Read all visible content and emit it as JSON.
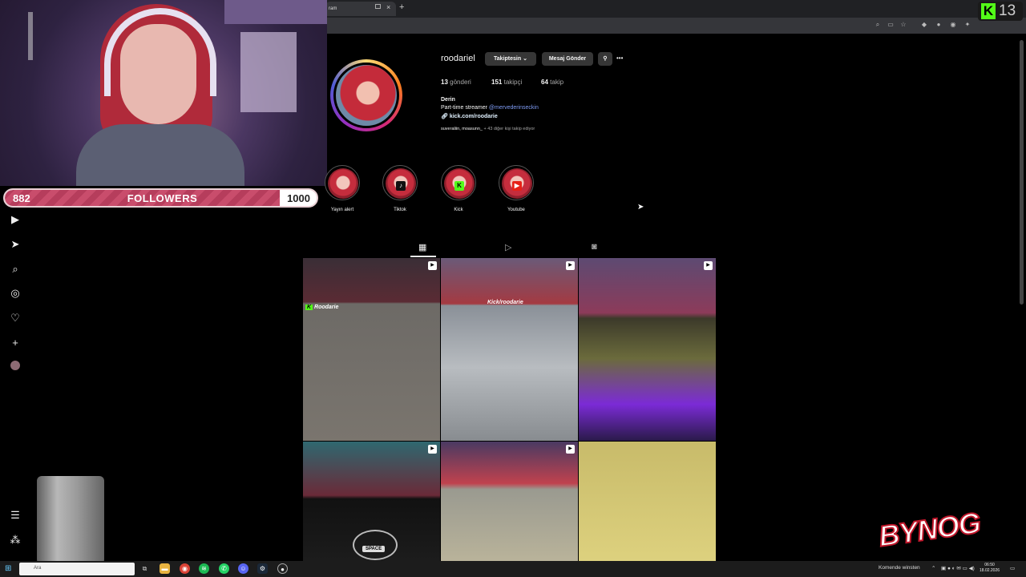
{
  "browser": {
    "tab_title": "ram",
    "tab_close": "×",
    "new_tab": "+",
    "kick_logo_letter": "K",
    "kick_count": "13"
  },
  "overlay": {
    "followers_current": "882",
    "followers_label": "FOLLOWERS",
    "followers_goal": "1000",
    "followers_progress": 0.882
  },
  "profile": {
    "username": "roodariel",
    "follow_button": "Takiptesin",
    "message_button": "Mesaj Gönder",
    "more": "•••",
    "posts_count": "13",
    "posts_label": "gönderi",
    "followers_count": "151",
    "followers_label": "takipçi",
    "following_count": "64",
    "following_label": "takip",
    "bio_name": "Derin",
    "bio_text": "Part-time streamer",
    "bio_mention": "@mervederinseckin",
    "bio_link": "kick.com/roodarie",
    "followed_by_names": "suveraliin, moasunn_",
    "followed_by_rest": "+ 43 diğer kişi takip ediyor"
  },
  "highlights": [
    {
      "label": "Yayın alert"
    },
    {
      "label": "Tiktok"
    },
    {
      "label": "Kick"
    },
    {
      "label": "Youtube"
    }
  ],
  "grid": {
    "label_kick_green": "Roodarie",
    "label_kick_slash": "Kick/roodarie",
    "space_label": "SPACE"
  },
  "taskbar": {
    "search_placeholder": "Ara",
    "weather_text": "Komende winsten",
    "time": "06:50",
    "date": "18.02.2026"
  },
  "logo_text": "BYNOG",
  "colors": {
    "accent_follow_bar": "#c94d6c",
    "kick_green": "#53fc18",
    "link_blue": "#7f9cf5"
  }
}
